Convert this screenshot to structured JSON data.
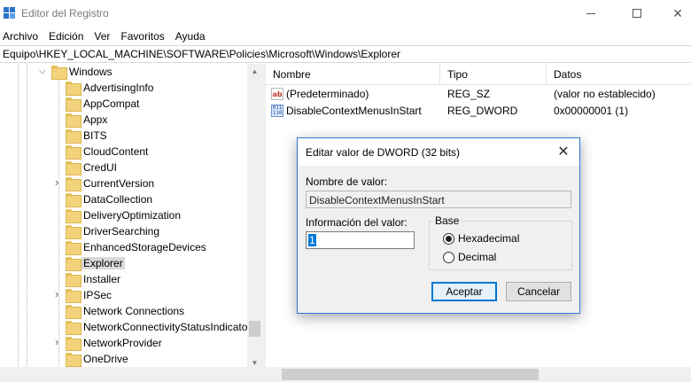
{
  "window": {
    "title": "Editor del Registro"
  },
  "menu": [
    "Archivo",
    "Edición",
    "Ver",
    "Favoritos",
    "Ayuda"
  ],
  "address": "Equipo\\HKEY_LOCAL_MACHINE\\SOFTWARE\\Policies\\Microsoft\\Windows\\Explorer",
  "tree": {
    "parent": "Windows",
    "items": [
      {
        "label": "AdvertisingInfo",
        "expandable": false
      },
      {
        "label": "AppCompat",
        "expandable": false
      },
      {
        "label": "Appx",
        "expandable": false
      },
      {
        "label": "BITS",
        "expandable": false
      },
      {
        "label": "CloudContent",
        "expandable": false
      },
      {
        "label": "CredUI",
        "expandable": false
      },
      {
        "label": "CurrentVersion",
        "expandable": true
      },
      {
        "label": "DataCollection",
        "expandable": false
      },
      {
        "label": "DeliveryOptimization",
        "expandable": false
      },
      {
        "label": "DriverSearching",
        "expandable": false
      },
      {
        "label": "EnhancedStorageDevices",
        "expandable": false
      },
      {
        "label": "Explorer",
        "expandable": false,
        "selected": true
      },
      {
        "label": "Installer",
        "expandable": false
      },
      {
        "label": "IPSec",
        "expandable": true
      },
      {
        "label": "Network Connections",
        "expandable": false
      },
      {
        "label": "NetworkConnectivityStatusIndicator",
        "expandable": false
      },
      {
        "label": "NetworkProvider",
        "expandable": true
      },
      {
        "label": "OneDrive",
        "expandable": false
      }
    ]
  },
  "list": {
    "headers": {
      "name": "Nombre",
      "type": "Tipo",
      "data": "Datos"
    },
    "rows": [
      {
        "icon": "string-value-icon",
        "name": "(Predeterminado)",
        "type": "REG_SZ",
        "data": "(valor no establecido)"
      },
      {
        "icon": "binary-value-icon",
        "name": "DisableContextMenusInStart",
        "type": "REG_DWORD",
        "data": "0x00000001 (1)"
      }
    ]
  },
  "dialog": {
    "title": "Editar valor de DWORD (32 bits)",
    "name_label": "Nombre de valor:",
    "name_value": "DisableContextMenusInStart",
    "value_label": "Información del valor:",
    "value": "1",
    "base_label": "Base",
    "base_options": [
      {
        "label": "Hexadecimal",
        "checked": true
      },
      {
        "label": "Decimal",
        "checked": false
      }
    ],
    "ok_label": "Aceptar",
    "cancel_label": "Cancelar"
  },
  "colors": {
    "accent": "#0078d7",
    "folder": "#f2d37b",
    "selection": "#d9d9d9"
  }
}
